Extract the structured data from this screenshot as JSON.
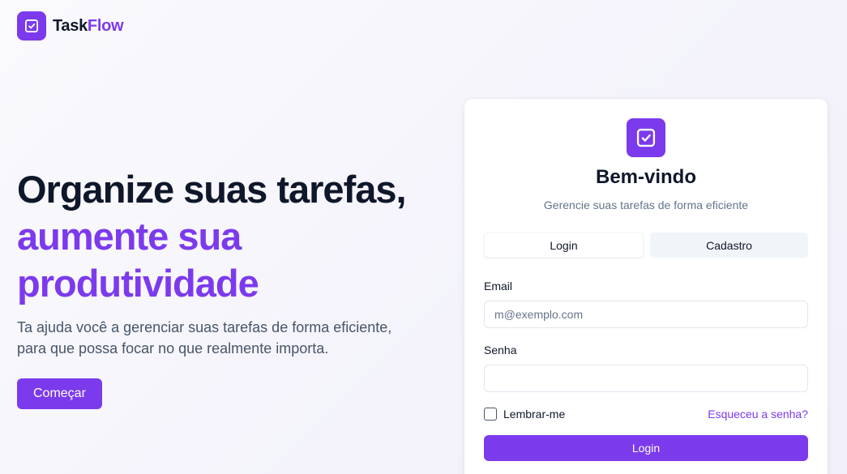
{
  "brand": {
    "name_part1": "Task",
    "name_part2": "Flow",
    "icon": "check-square-icon",
    "accent_color": "#7c3aed"
  },
  "hero": {
    "headline_line1": "Organize suas tarefas,",
    "headline_line2": "aumente sua",
    "headline_line3": "produtividade",
    "description": "Ta ajuda você a gerenciar suas tarefas de forma eficiente, para que possa focar no que realmente importa.",
    "cta_label": "Começar"
  },
  "auth_card": {
    "icon": "check-square-icon",
    "title": "Bem-vindo",
    "subtitle": "Gerencie suas tarefas de forma eficiente",
    "tabs": [
      {
        "label": "Login",
        "active": true
      },
      {
        "label": "Cadastro",
        "active": false
      }
    ],
    "email_label": "Email",
    "email_value": "",
    "email_placeholder": "m@exemplo.com",
    "password_label": "Senha",
    "password_value": "",
    "password_placeholder": "",
    "remember_label": "Lembrar-me",
    "remember_checked": false,
    "forgot_label": "Esqueceu a senha?",
    "submit_label": "Login"
  }
}
